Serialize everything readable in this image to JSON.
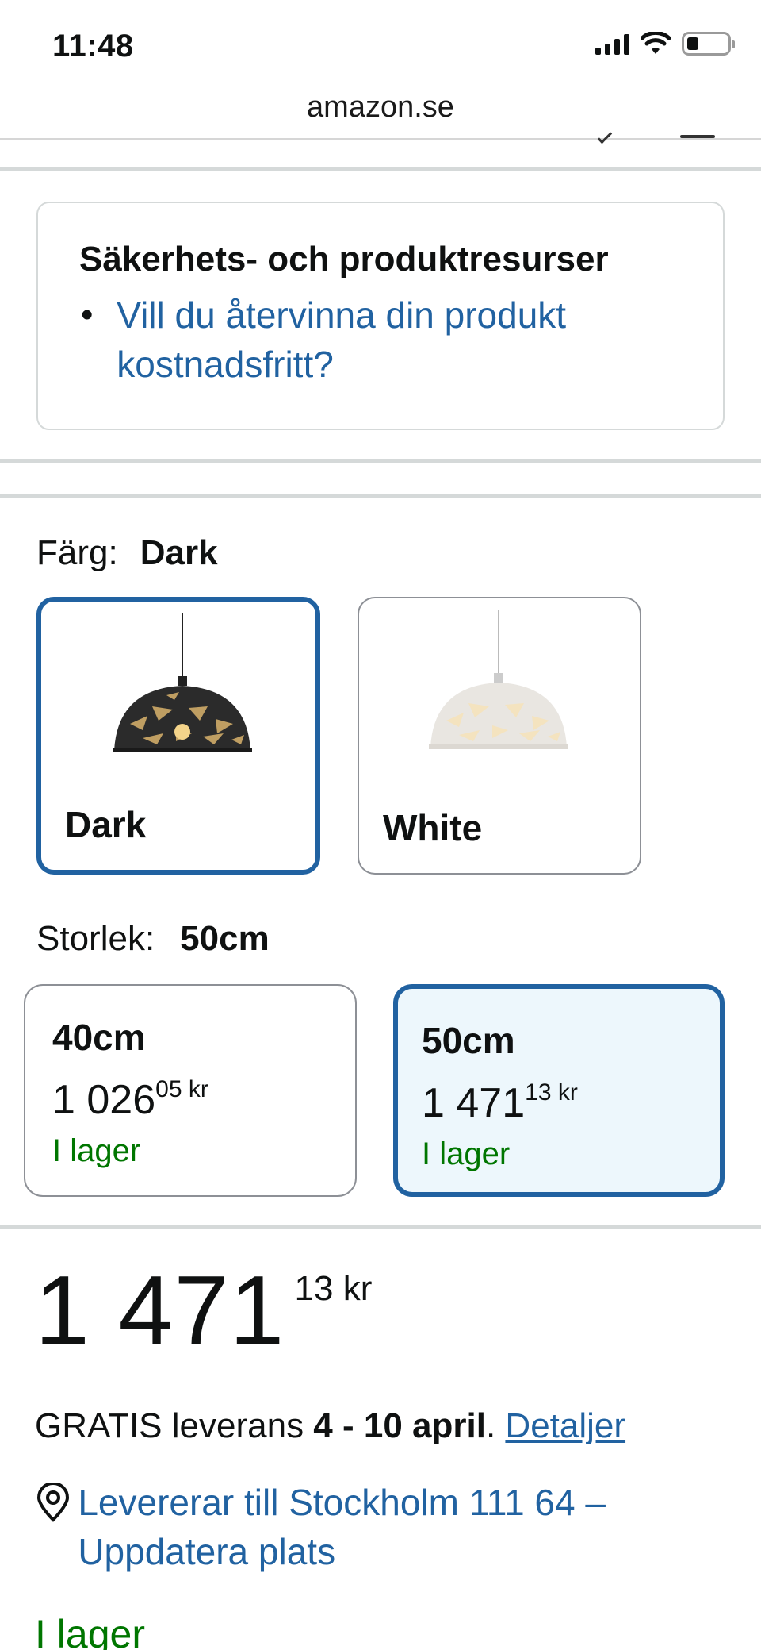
{
  "status_bar": {
    "time": "11:48",
    "icons": [
      "signal-icon",
      "wifi-icon",
      "battery-icon"
    ]
  },
  "browser": {
    "url": "amazon.se"
  },
  "safety": {
    "title": "Säkerhets- och produktresurser",
    "link": "Vill du återvinna din produkt kostnadsfritt?"
  },
  "color": {
    "label": "Färg:",
    "selected": "Dark",
    "options": [
      {
        "label": "Dark",
        "selected": true
      },
      {
        "label": "White",
        "selected": false
      }
    ]
  },
  "size": {
    "label": "Storlek:",
    "selected": "50cm",
    "options": [
      {
        "name": "40cm",
        "price_main": "1 026",
        "price_fraction": "05",
        "currency": "kr",
        "stock": "I lager",
        "selected": false
      },
      {
        "name": "50cm",
        "price_main": "1 471",
        "price_fraction": "13",
        "currency": "kr",
        "stock": "I lager",
        "selected": true
      }
    ]
  },
  "price": {
    "main": "1 471",
    "fraction": "13",
    "currency": "kr"
  },
  "delivery": {
    "prefix": "GRATIS leverans ",
    "dates": "4 - 10 april",
    "suffix": ". ",
    "details_link": "Detaljer"
  },
  "location": {
    "text": "Levererar till Stockholm 111 64 – Uppdatera plats"
  },
  "availability": "I lager",
  "colors": {
    "link": "#2162a1",
    "in_stock": "#007600",
    "selected_border": "#2162a1",
    "selected_bg": "#edf7fc"
  }
}
